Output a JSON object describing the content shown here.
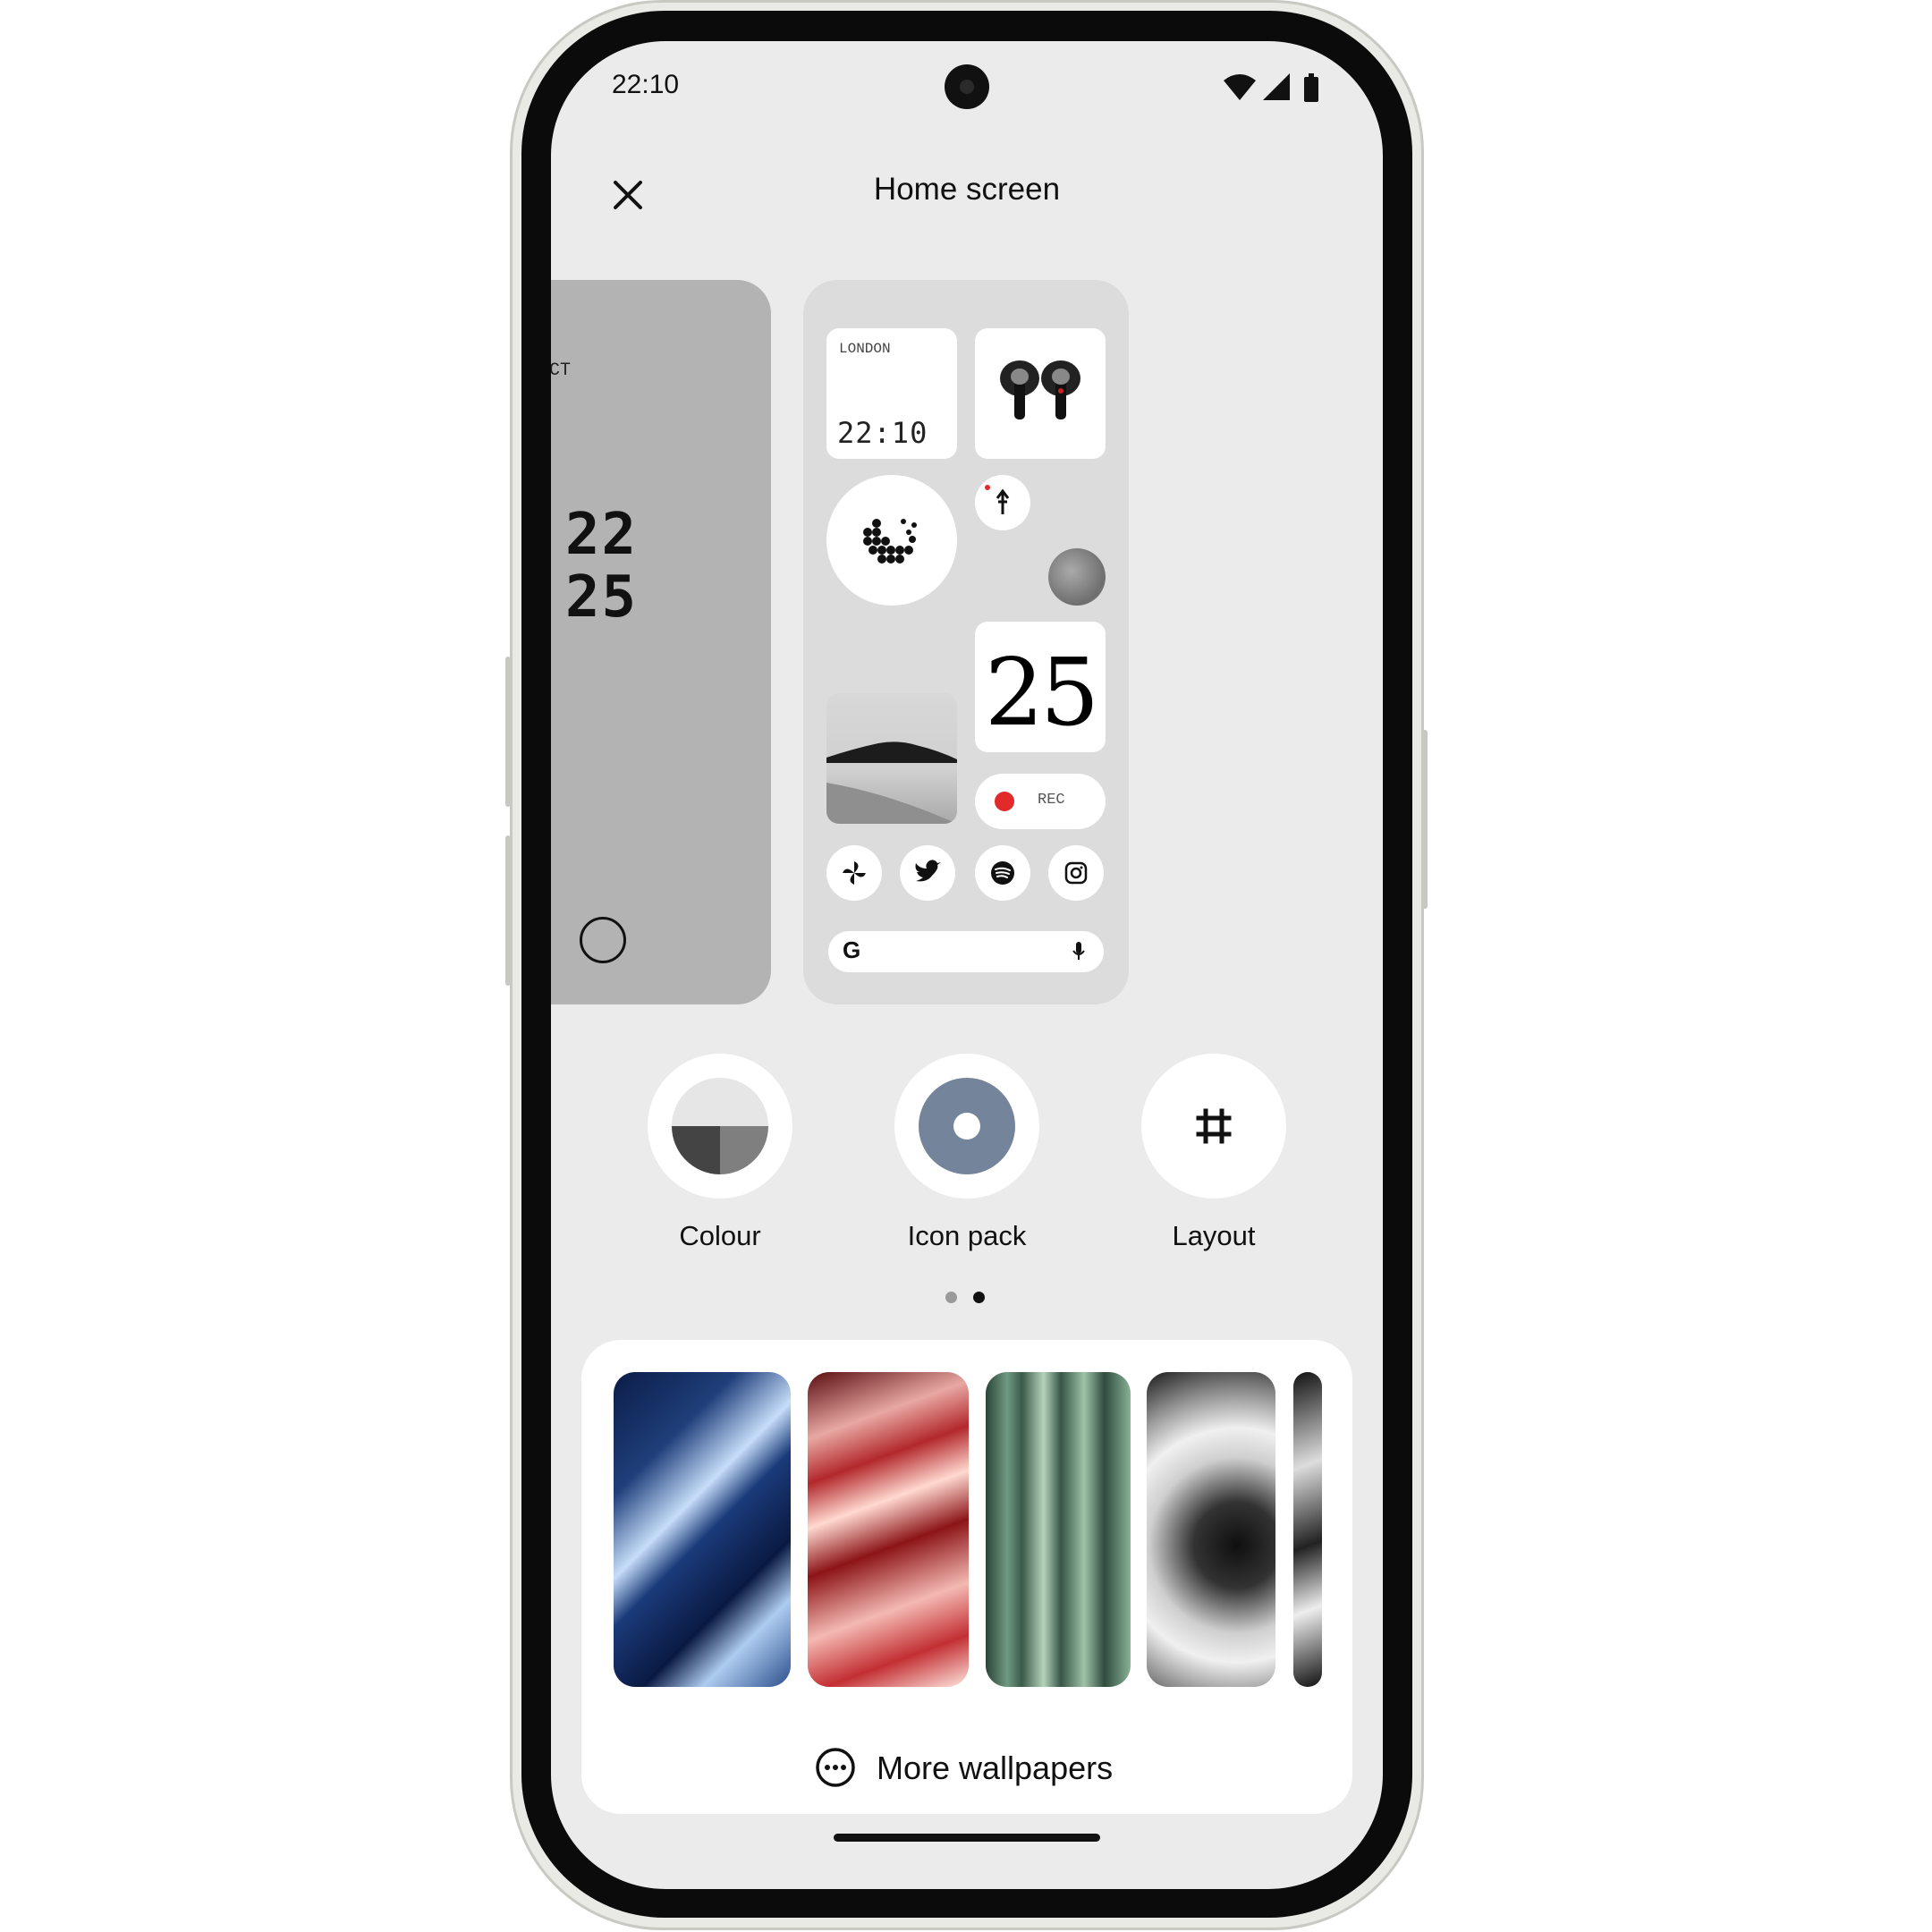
{
  "status_bar": {
    "time": "22:10",
    "icons": [
      "wifi-icon",
      "signal-icon",
      "battery-icon"
    ]
  },
  "header": {
    "title": "Home screen",
    "close_icon": "close-icon"
  },
  "previews": {
    "left": {
      "label": "CT",
      "digits_top": "22",
      "digits_bottom": "25"
    },
    "right": {
      "clock_widget": {
        "city": "LONDON",
        "time": "22:10"
      },
      "date_widget": {
        "day": "25"
      },
      "recorder_widget": {
        "label": "REC",
        "accent": "#e32a2a"
      },
      "app_icons": [
        "pinwheel-icon",
        "twitter-icon",
        "spotify-icon",
        "instagram-icon"
      ],
      "search_bar": {
        "logo": "G"
      }
    },
    "page_dots": {
      "count": 2,
      "active_index": 1
    }
  },
  "options": [
    {
      "label": "Colour",
      "icon": "colour-palette-icon"
    },
    {
      "label": "Icon pack",
      "icon": "icon-pack-icon"
    },
    {
      "label": "Layout",
      "icon": "grid-hash-icon"
    }
  ],
  "wallpapers": {
    "items": [
      {
        "name": "blue-neon",
        "colors": [
          "#0e2353",
          "#bcd9f2"
        ]
      },
      {
        "name": "red-neon",
        "colors": [
          "#7a1416",
          "#ffd0c8"
        ]
      },
      {
        "name": "green-neon",
        "colors": [
          "#2f4a3d",
          "#a8c8ad"
        ]
      },
      {
        "name": "mono-shapes",
        "colors": [
          "#111111",
          "#e5e5e5"
        ]
      },
      {
        "name": "mono-partial",
        "colors": [
          "#111111",
          "#dddddd"
        ]
      }
    ],
    "more_label": "More wallpapers",
    "more_icon": "more-horizontal-circle-icon"
  }
}
